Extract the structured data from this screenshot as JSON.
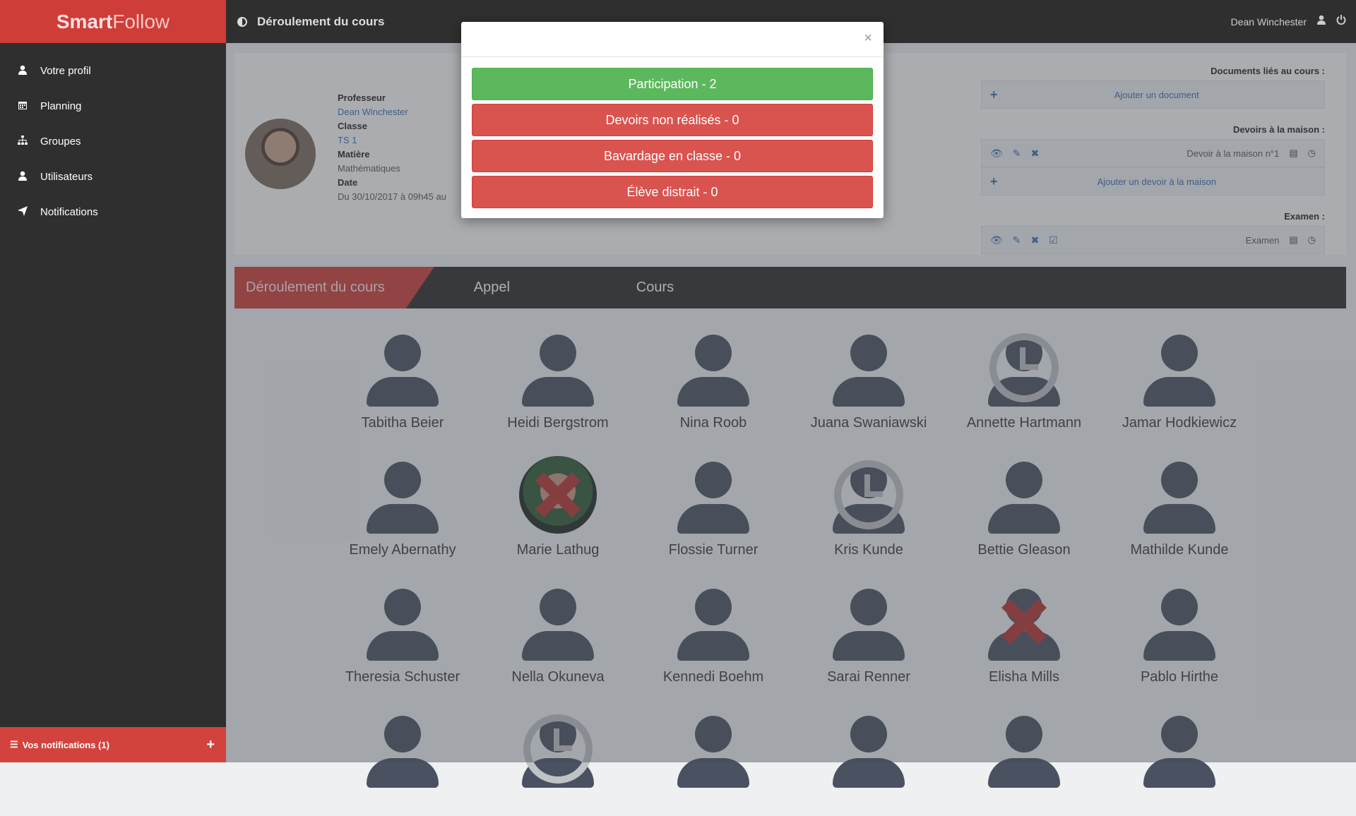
{
  "app": {
    "brand_part1": "Smart",
    "brand_part2": "Follow"
  },
  "topbar": {
    "title": "Déroulement du cours",
    "user": "Dean Winchester"
  },
  "sidebar": {
    "items": [
      {
        "label": "Votre profil",
        "icon": "user-icon"
      },
      {
        "label": "Planning",
        "icon": "calendar-icon"
      },
      {
        "label": "Groupes",
        "icon": "sitemap-icon"
      },
      {
        "label": "Utilisateurs",
        "icon": "user-icon"
      },
      {
        "label": "Notifications",
        "icon": "send-icon"
      }
    ],
    "notifications_label": "Vos notifications (1)"
  },
  "course": {
    "prof_label": "Professeur",
    "prof_value": "Dean Winchester",
    "class_label": "Classe",
    "class_value": "TS 1",
    "subject_label": "Matière",
    "subject_value": "Mathématiques",
    "date_label": "Date",
    "date_value": "Du 30/10/2017 à 09h45 au"
  },
  "docs": {
    "documents_title": "Documents liés au cours :",
    "add_document": "Ajouter un document",
    "homework_title": "Devoirs à la maison :",
    "homework_item": "Devoir à la maison n°1",
    "add_homework": "Ajouter un devoir à la maison",
    "exam_title": "Examen :",
    "exam_item": "Examen"
  },
  "tabs": [
    {
      "label": "Déroulement du cours"
    },
    {
      "label": "Appel"
    },
    {
      "label": "Cours"
    }
  ],
  "students": [
    {
      "name": "Tabitha Beier",
      "status": "none"
    },
    {
      "name": "Heidi Bergstrom",
      "status": "none"
    },
    {
      "name": "Nina Roob",
      "status": "none"
    },
    {
      "name": "Juana Swaniawski",
      "status": "none"
    },
    {
      "name": "Annette Hartmann",
      "status": "late"
    },
    {
      "name": "Jamar Hodkiewicz",
      "status": "none"
    },
    {
      "name": "Emely Abernathy",
      "status": "none"
    },
    {
      "name": "Marie Lathug",
      "status": "absent-photo"
    },
    {
      "name": "Flossie Turner",
      "status": "none"
    },
    {
      "name": "Kris Kunde",
      "status": "late"
    },
    {
      "name": "Bettie Gleason",
      "status": "none"
    },
    {
      "name": "Mathilde Kunde",
      "status": "none"
    },
    {
      "name": "Theresia Schuster",
      "status": "none"
    },
    {
      "name": "Nella Okuneva",
      "status": "none"
    },
    {
      "name": "Kennedi Boehm",
      "status": "none"
    },
    {
      "name": "Sarai Renner",
      "status": "none"
    },
    {
      "name": "Elisha Mills",
      "status": "absent"
    },
    {
      "name": "Pablo Hirthe",
      "status": "none"
    },
    {
      "name": "",
      "status": "none"
    },
    {
      "name": "",
      "status": "late"
    },
    {
      "name": "",
      "status": "none"
    },
    {
      "name": "",
      "status": "none"
    },
    {
      "name": "",
      "status": "none"
    },
    {
      "name": "",
      "status": "none"
    }
  ],
  "modal": {
    "close": "×",
    "buttons": [
      {
        "label": "Participation - 2",
        "color": "#5cb85c"
      },
      {
        "label": "Devoirs non réalisés - 0",
        "color": "#d9534f"
      },
      {
        "label": "Bavardage en classe - 0",
        "color": "#d9534f"
      },
      {
        "label": "Élève distrait - 0",
        "color": "#d9534f"
      }
    ]
  },
  "colors": {
    "brand": "#cf3d38",
    "sidebar": "#2f2f2f",
    "accent_link": "#3a6fb0"
  }
}
